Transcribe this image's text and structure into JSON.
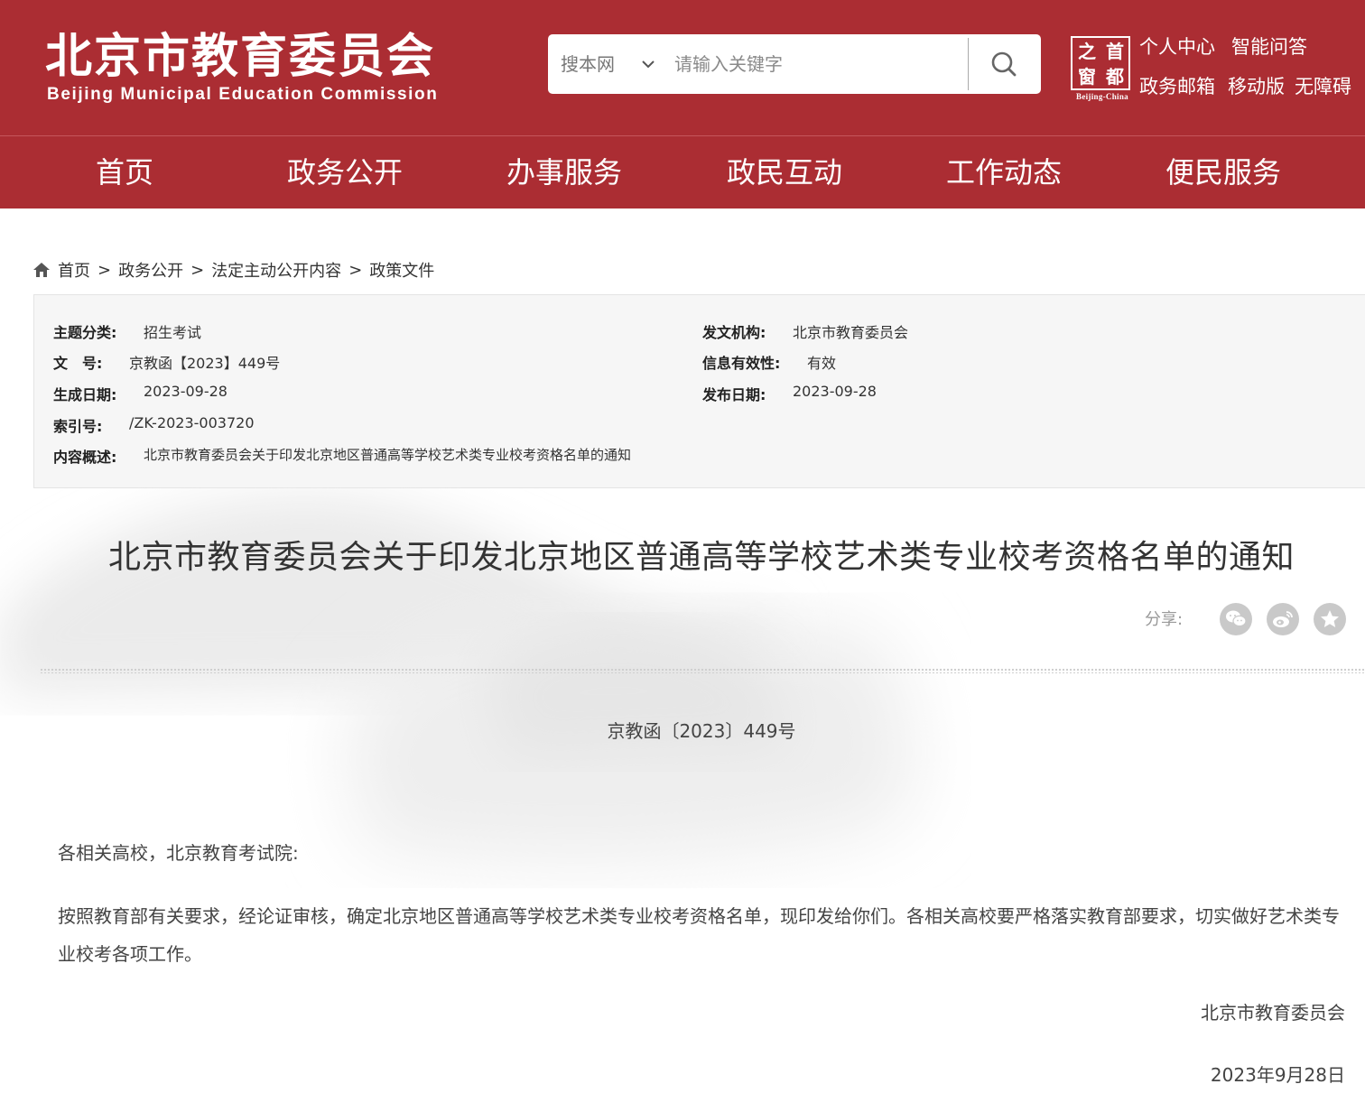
{
  "header": {
    "logo_cn": "北京市教育委员会",
    "logo_en": "Beijing Municipal Education Commission",
    "search": {
      "scope": "搜本网",
      "placeholder": "请输入关键字"
    },
    "seal": {
      "chars": [
        "之",
        "首",
        "窗",
        "都"
      ],
      "en": "Beijing-China"
    },
    "links": [
      "个人中心",
      "智能问答",
      "政务邮箱",
      "移动版",
      "无障碍"
    ]
  },
  "nav": {
    "items": [
      "首页",
      "政务公开",
      "办事服务",
      "政民互动",
      "工作动态",
      "便民服务"
    ]
  },
  "breadcrumb": {
    "items": [
      "首页",
      "政务公开",
      "法定主动公开内容",
      "政策文件"
    ],
    "separator": ">"
  },
  "meta": {
    "topic_label": "主题分类:",
    "topic": "招生考试",
    "issuer_label": "发文机构:",
    "issuer": "北京市教育委员会",
    "docno_label": "文　号:",
    "docno": "京教函【2023】449号",
    "validity_label": "信息有效性:",
    "validity": "有效",
    "created_label": "生成日期:",
    "created": "2023-09-28",
    "published_label": "发布日期:",
    "published": "2023-09-28",
    "index_label": "索引号:",
    "index": "/ZK-2023-003720",
    "summary_label": "内容概述:",
    "summary": "北京市教育委员会关于印发北京地区普通高等学校艺术类专业校考资格名单的通知"
  },
  "article": {
    "title": "北京市教育委员会关于印发北京地区普通高等学校艺术类专业校考资格名单的通知",
    "share_label": "分享:",
    "share_icons": [
      "wechat-icon",
      "weibo-icon",
      "favorite-icon"
    ],
    "doc_number": "京教函〔2023〕449号",
    "salutation": "各相关高校，北京教育考试院:",
    "body": "按照教育部有关要求，经论证审核，确定北京地区普通高等学校艺术类专业校考资格名单，现印发给你们。各相关高校要严格落实教育部要求，切实做好艺术类专业校考各项工作。",
    "signature": "北京市教育委员会",
    "date": "2023年9月28日"
  },
  "colors": {
    "brand_red": "#ab2d33",
    "meta_bg": "#f6f6f6",
    "share_icon_bg": "#c9c9c9"
  }
}
